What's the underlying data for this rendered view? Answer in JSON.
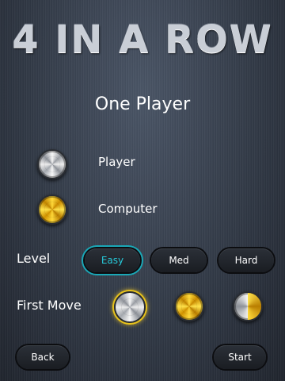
{
  "header": {
    "title": "4 IN A ROW",
    "subtitle": "One Player"
  },
  "legend": {
    "player_label": "Player",
    "computer_label": "Computer",
    "player_color": "silver",
    "computer_color": "gold"
  },
  "level": {
    "label": "Level",
    "options": [
      "Easy",
      "Med",
      "Hard"
    ],
    "selected": "Easy",
    "accent": "#1aa7b6"
  },
  "first_move": {
    "label": "First Move",
    "options": [
      "player-silver",
      "computer-gold",
      "random-half"
    ],
    "selected": "player-silver",
    "selection_color": "#e7c21a"
  },
  "footer": {
    "back_label": "Back",
    "start_label": "Start"
  }
}
